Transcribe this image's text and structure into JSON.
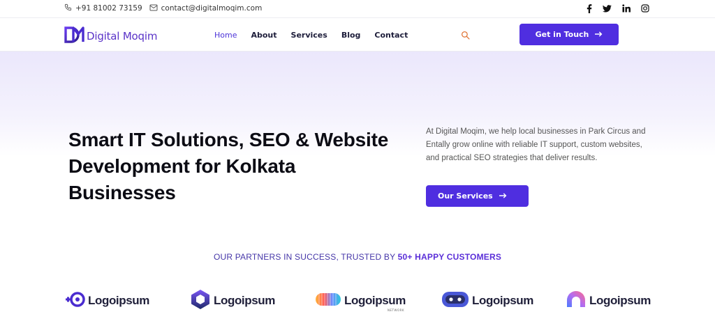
{
  "topbar": {
    "phone": "+91 81002 73159",
    "email": "contact@digitalmoqim.com",
    "social": [
      "facebook-icon",
      "twitter-icon",
      "linkedin-icon",
      "instagram-icon"
    ]
  },
  "header": {
    "logo_text": "Digital Moqim",
    "nav": [
      "Home",
      "About",
      "Services",
      "Blog",
      "Contact"
    ],
    "active_nav": "Home",
    "cta_label": "Get in Touch"
  },
  "hero": {
    "title": "Smart IT Solutions, SEO & Website Development for Kolkata Businesses",
    "description": "At Digital Moqim, we help local businesses in Park Circus and Entally grow online with reliable IT support, custom websites, and practical SEO strategies that deliver results.",
    "button_label": "Our Services"
  },
  "partners": {
    "heading_prefix": "OUR PARTNERS IN SUCCESS, TRUSTED BY ",
    "heading_highlight": "50+ HAPPY CUSTOMERS",
    "logos": [
      {
        "name": "Logoipsum"
      },
      {
        "name": "Logoipsum"
      },
      {
        "name": "Logoipsum",
        "sub": "NETWORK"
      },
      {
        "name": "Logoipsum"
      },
      {
        "name": "Logoipsum"
      }
    ]
  },
  "colors": {
    "brand": "#4f2ee0",
    "heading_text": "#0c0c14",
    "hero_gradient_top": "#ebe7fc"
  }
}
